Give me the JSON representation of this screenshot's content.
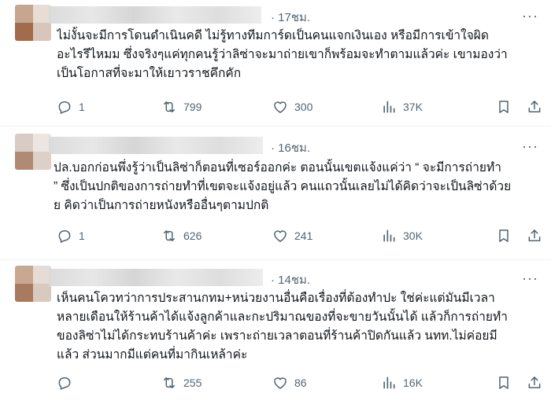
{
  "posts": [
    {
      "time": "17ชม.",
      "more": "···",
      "lines": [
        "ไม่งั้นจะมีการโดนดำเนินคดี ไม่รู้ทางทีมการ์ดเป็นคนแจกเงินเอง หรือมีการเข้าใจผิด",
        "อะไรรึไหมม ซึ่งจริงๆแค่ทุกคนรู้ว่าลิซ่าจะมาถ่ายเขาก็พร้อมจะทำตามแล้วค่ะ เขามองว่า",
        "เป็นโอกาสที่จะมาให้เยาวราชคึกคัก"
      ],
      "replies": "1",
      "reposts": "799",
      "likes": "300",
      "views": "37K"
    },
    {
      "time": "16ชม.",
      "more": "···",
      "lines": [
        "ปล.บอกก่อนพึ่งรู้ว่าเป็นลิซ่าก็ตอนที่เซอร์ออกค่ะ ตอนนั้นเขตแจ้งแค่ว่า “ จะมีการถ่ายทำ",
        "” ซึ่งเป็นปกติของการถ่ายทำที่เขตจะแจ้งอยู่แล้ว คนแถวนั้นเลยไม่ได้คิดว่าจะเป็นลิซ่าด้วย",
        "ย คิดว่าเป็นการถ่ายหนังหรืออื่นๆตามปกติ"
      ],
      "replies": "1",
      "reposts": "626",
      "likes": "241",
      "views": "30K"
    },
    {
      "time": "14ชม.",
      "more": "···",
      "lines": [
        "เห็นคนโควทว่าการประสานกทม+หน่วยงานอื่นคือเรื่องที่ต้องทำปะ ใช่ค่ะแต่มันมีเวลา",
        "หลายเดือนให้ร้านค้าได้แจ้งลูกค้าและกะปริมาณของที่จะขายวันนั้นได้ แล้วก็การถ่ายทำ",
        "ของลิซ่าไม่ได้กระทบร้านค้าค่ะ เพราะถ่ายเวลาตอนที่ร้านค้าปิดกันแล้ว นทท.ไม่ค่อยมี",
        "แล้ว ส่วนมากมีแต่คนที่มากินเหล้าค่ะ"
      ],
      "replies": "",
      "reposts": "255",
      "likes": "86",
      "views": "16K"
    }
  ],
  "icons": {
    "reply": "reply-icon",
    "repost": "repost-icon",
    "like": "heart-icon",
    "views": "analytics-icon",
    "bookmark": "bookmark-icon",
    "share": "share-icon"
  },
  "colors": {
    "text": "#0f1419",
    "secondary": "#536471",
    "divider": "#eff3f4"
  }
}
